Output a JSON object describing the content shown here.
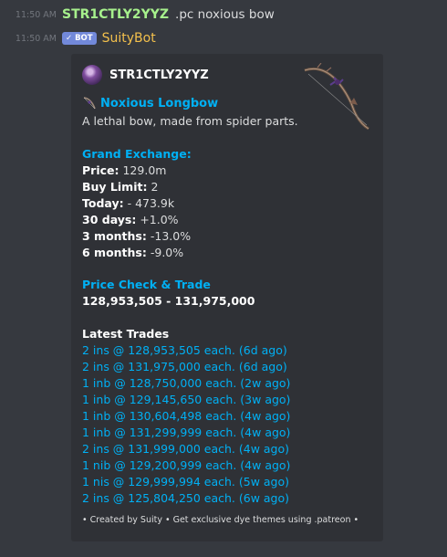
{
  "messages": [
    {
      "time": "11:50 AM",
      "author": "STR1CTLY2YYZ",
      "text": ".pc noxious bow"
    },
    {
      "time": "11:50 AM",
      "badge": "✓ BOT",
      "author": "SuityBot"
    }
  ],
  "embed": {
    "author": "STR1CTLY2YYZ",
    "item_name": "Noxious Longbow",
    "description": "A lethal bow, made from spider parts.",
    "ge": {
      "title": "Grand Exchange:",
      "rows": [
        {
          "label": "Price:",
          "value": "129.0m"
        },
        {
          "label": "Buy Limit:",
          "value": "2"
        },
        {
          "label": "Today:",
          "value": "- 473.9k"
        },
        {
          "label": "30 days:",
          "value": "+1.0%"
        },
        {
          "label": "3 months:",
          "value": "-13.0%"
        },
        {
          "label": "6 months:",
          "value": "-9.0%"
        }
      ]
    },
    "price_check": {
      "title": "Price Check & Trade",
      "range": "128,953,505 - 131,975,000"
    },
    "latest_trades": {
      "title": "Latest Trades",
      "items": [
        "2 ins @ 128,953,505 each. (6d ago)",
        "2 ins @ 131,975,000 each. (6d ago)",
        "1 inb @ 128,750,000 each. (2w ago)",
        "1 inb @ 129,145,650 each. (3w ago)",
        "1 inb @ 130,604,498 each. (4w ago)",
        "1 inb @ 131,299,999 each. (4w ago)",
        "2 ins @ 131,999,000 each. (4w ago)",
        "1 nib @ 129,200,999 each. (4w ago)",
        "1 nis @ 129,999,994 each. (5w ago)",
        "2 ins @ 125,804,250 each. (6w ago)"
      ]
    },
    "footer": "• Created by Suity • Get exclusive dye themes using .patreon •"
  },
  "colors": {
    "background": "#36393f",
    "embed_background": "#2f3136",
    "link": "#00b0f4",
    "user_name": "#a6f08c",
    "bot_name": "#f3c04c",
    "bot_badge": "#7289da"
  }
}
